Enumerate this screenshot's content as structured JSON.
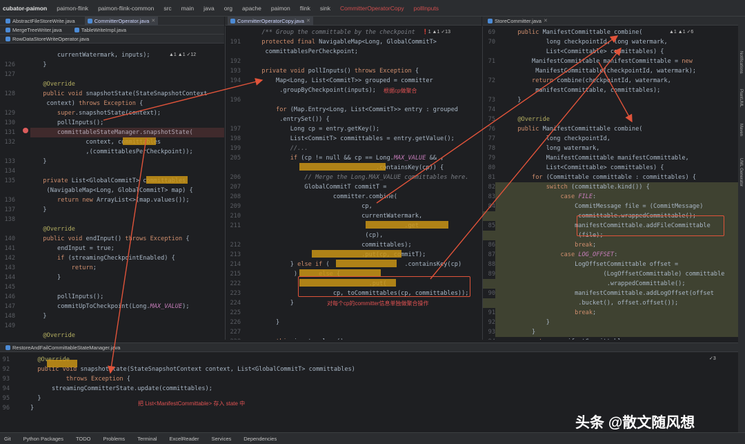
{
  "breadcrumb": [
    "cubator-paimon",
    "paimon-flink",
    "paimon-flink-common",
    "src",
    "main",
    "java",
    "org",
    "apache",
    "paimon",
    "flink",
    "sink",
    "CommitterOperatorCopy",
    "pollInputs"
  ],
  "left_tabs": {
    "row1": [
      "AbstractFileStoreWrite.java",
      "CommitterOperator.java"
    ],
    "row2": [
      "MergeTreeWriter.java",
      "TableWriteImpl.java"
    ],
    "row3": [
      "RowDataStoreWriteOperator.java"
    ]
  },
  "mid_tab": "CommitterOperatorCopy.java",
  "right_tab": "StoreCommitter.java",
  "bottom_tab": "RestoreAndFailCommittableStateManager.java",
  "left_pane": {
    "warn": "▲1 ▲1 ✓12",
    "lines": [
      {
        "n": "",
        "t": "      currentWatermark, inputs);"
      },
      {
        "n": "126",
        "t": "  }"
      },
      {
        "n": "127",
        "t": ""
      },
      {
        "n": "",
        "t": "  @Override"
      },
      {
        "n": "128",
        "t": "  public void snapshotState(StateSnapshotContext"
      },
      {
        "n": "",
        "t": "   context) throws Exception {"
      },
      {
        "n": "129",
        "t": "      super.snapshotState(context);"
      },
      {
        "n": "130",
        "t": "      pollInputs();"
      },
      {
        "n": "131",
        "t": "      committableStateManager.snapshotState("
      },
      {
        "n": "132",
        "t": "              context, committables"
      },
      {
        "n": "",
        "t": "              ,(committablesPerCheckpoint));"
      },
      {
        "n": "133",
        "t": "  }"
      },
      {
        "n": "134",
        "t": ""
      },
      {
        "n": "135",
        "t": "  private List<GlobalCommitT> committables"
      },
      {
        "n": "",
        "t": "   (NavigableMap<Long, GlobalCommitT> map) {"
      },
      {
        "n": "136",
        "t": "      return new ArrayList<>(map.values());"
      },
      {
        "n": "137",
        "t": "  }"
      },
      {
        "n": "138",
        "t": ""
      },
      {
        "n": "",
        "t": "  @Override"
      },
      {
        "n": "140",
        "t": "  public void endInput() throws Exception {"
      },
      {
        "n": "141",
        "t": "      endInput = true;"
      },
      {
        "n": "142",
        "t": "      if (streamingCheckpointEnabled) {"
      },
      {
        "n": "143",
        "t": "          return;"
      },
      {
        "n": "144",
        "t": "      }"
      },
      {
        "n": "145",
        "t": ""
      },
      {
        "n": "146",
        "t": "      pollInputs();"
      },
      {
        "n": "147",
        "t": "      commitUpToCheckpoint(Long.MAX_VALUE);"
      },
      {
        "n": "148",
        "t": "  }"
      },
      {
        "n": "149",
        "t": ""
      },
      {
        "n": "",
        "t": "  @Override"
      }
    ]
  },
  "mid_pane": {
    "warn": "❗1 ▲1 ✓13",
    "lines": [
      {
        "n": "",
        "t": "  /** Group the committable by the checkpoint"
      },
      {
        "n": "191",
        "t": "  protected final NavigableMap<Long, GlobalCommitT>"
      },
      {
        "n": "",
        "t": "   committablesPerCheckpoint;"
      },
      {
        "n": "192",
        "t": ""
      },
      {
        "n": "193",
        "t": "  private void pollInputs() throws Exception {"
      },
      {
        "n": "194",
        "t": "      Map<Long, List<CommitT>> grouped = committer"
      },
      {
        "n": "",
        "t": "       .groupByCheckpoint(inputs);"
      },
      {
        "n": "196",
        "t": ""
      },
      {
        "n": "",
        "t": "      for (Map.Entry<Long, List<CommitT>> entry : grouped"
      },
      {
        "n": "",
        "t": "       .entrySet()) {"
      },
      {
        "n": "197",
        "t": "          Long cp = entry.getKey();"
      },
      {
        "n": "198",
        "t": "          List<CommitT> committables = entry.getValue();"
      },
      {
        "n": "199",
        "t": "          //..."
      },
      {
        "n": "205",
        "t": "          if (cp != null && cp == Long.MAX_VALUE && ,"
      },
      {
        "n": "",
        "t": "                                  .containsKey(cp)) {"
      },
      {
        "n": "206",
        "t": "              // Merge the Long.MAX_VALUE committables here."
      },
      {
        "n": "207",
        "t": "              GlobalCommitT commitT ="
      },
      {
        "n": "208",
        "t": "                      committer.combine("
      },
      {
        "n": "209",
        "t": "                              cp,"
      },
      {
        "n": "210",
        "t": "                              currentWatermark,"
      },
      {
        "n": "211",
        "t": "                                          .get"
      },
      {
        "n": "",
        "t": "                               (cp),"
      },
      {
        "n": "212",
        "t": "                              committables);"
      },
      {
        "n": "213",
        "t": "                              .put(cp, commitT);"
      },
      {
        "n": "214",
        "t": "          } else if (                     .containsKey(cp)"
      },
      {
        "n": "215",
        "t": "           )      else {"
      },
      {
        "n": "222",
        "t": "                                .put("
      },
      {
        "n": "223",
        "t": "                      cp, toCommittables(cp, committables));"
      },
      {
        "n": "224",
        "t": "          }"
      },
      {
        "n": "225",
        "t": ""
      },
      {
        "n": "226",
        "t": "      }"
      },
      {
        "n": "227",
        "t": ""
      },
      {
        "n": "228",
        "t": "      this.inputs.clear();"
      },
      {
        "n": "229",
        "t": "  }"
      }
    ],
    "note1": "根据cp做聚合",
    "note2": "对每个cp的committer信息单独做聚合操作"
  },
  "right_pane": {
    "warn": "▲1 ▲1 ✓6",
    "lines": [
      {
        "n": "69",
        "t": "  public ManifestCommittable combine("
      },
      {
        "n": "70",
        "t": "          long checkpointId, long watermark,"
      },
      {
        "n": "",
        "t": "          List<Committable> committables) {"
      },
      {
        "n": "71",
        "t": "      ManifestCommittable manifestCommittable = new"
      },
      {
        "n": "",
        "t": "       ManifestCommittable(checkpointId, watermark);"
      },
      {
        "n": "72",
        "t": "      return combine(checkpointId, watermark,"
      },
      {
        "n": "",
        "t": "       manifestCommittable, committables);"
      },
      {
        "n": "73",
        "t": "  }"
      },
      {
        "n": "74",
        "t": ""
      },
      {
        "n": "75",
        "t": "  @Override"
      },
      {
        "n": "76",
        "t": "  public ManifestCommittable combine("
      },
      {
        "n": "77",
        "t": "          long checkpointId,"
      },
      {
        "n": "78",
        "t": "          long watermark,"
      },
      {
        "n": "79",
        "t": "          ManifestCommittable manifestCommittable,"
      },
      {
        "n": "80",
        "t": "          List<Committable> committables) {"
      },
      {
        "n": "81",
        "t": "      for (Committable committable : committables) {"
      },
      {
        "n": "82",
        "t": "          switch (committable.kind()) {"
      },
      {
        "n": "83",
        "t": "              case FILE:"
      },
      {
        "n": "84",
        "t": "                  CommitMessage file = (CommitMessage)"
      },
      {
        "n": "",
        "t": "                   committable.wrappedCommittable();"
      },
      {
        "n": "85",
        "t": "                  manifestCommittable.addFileCommittable"
      },
      {
        "n": "",
        "t": "                   (file);"
      },
      {
        "n": "86",
        "t": "                  break;"
      },
      {
        "n": "87",
        "t": "              case LOG_OFFSET:"
      },
      {
        "n": "88",
        "t": "                  LogOffsetCommittable offset ="
      },
      {
        "n": "89",
        "t": "                          (LogOffsetCommittable) committable"
      },
      {
        "n": "",
        "t": "                           .wrappedCommittable();"
      },
      {
        "n": "90",
        "t": "                  manifestCommittable.addLogOffset(offset"
      },
      {
        "n": "",
        "t": "                   .bucket(), offset.offset());"
      },
      {
        "n": "91",
        "t": "                  break;"
      },
      {
        "n": "92",
        "t": "          }"
      },
      {
        "n": "93",
        "t": "      }"
      },
      {
        "n": "94",
        "t": "      return manifestCommittable;"
      }
    ]
  },
  "bottom_pane": {
    "warn": "✓3",
    "lines": [
      {
        "n": "91",
        "t": "  @Override"
      },
      {
        "n": "92",
        "t": "  public void snapshotState(StateSnapshotContext context, List<GlobalCommitT> committables)"
      },
      {
        "n": "93",
        "t": "          throws Exception {"
      },
      {
        "n": "94",
        "t": "      streamingCommitterState.update(committables);"
      },
      {
        "n": "95",
        "t": "  }"
      },
      {
        "n": "96",
        "t": "}"
      }
    ],
    "note": "把 List<ManifestCommittable> 存入 state 中"
  },
  "side_labels": [
    "Notifications",
    "PlantUML",
    "Maven",
    "UML Generator"
  ],
  "status_items": [
    "Git",
    "Python Packages",
    "TODO",
    "Problems",
    "Terminal",
    "ExcelReader",
    "Services",
    "Dependencies"
  ],
  "watermark": "头条 @散文随风想"
}
